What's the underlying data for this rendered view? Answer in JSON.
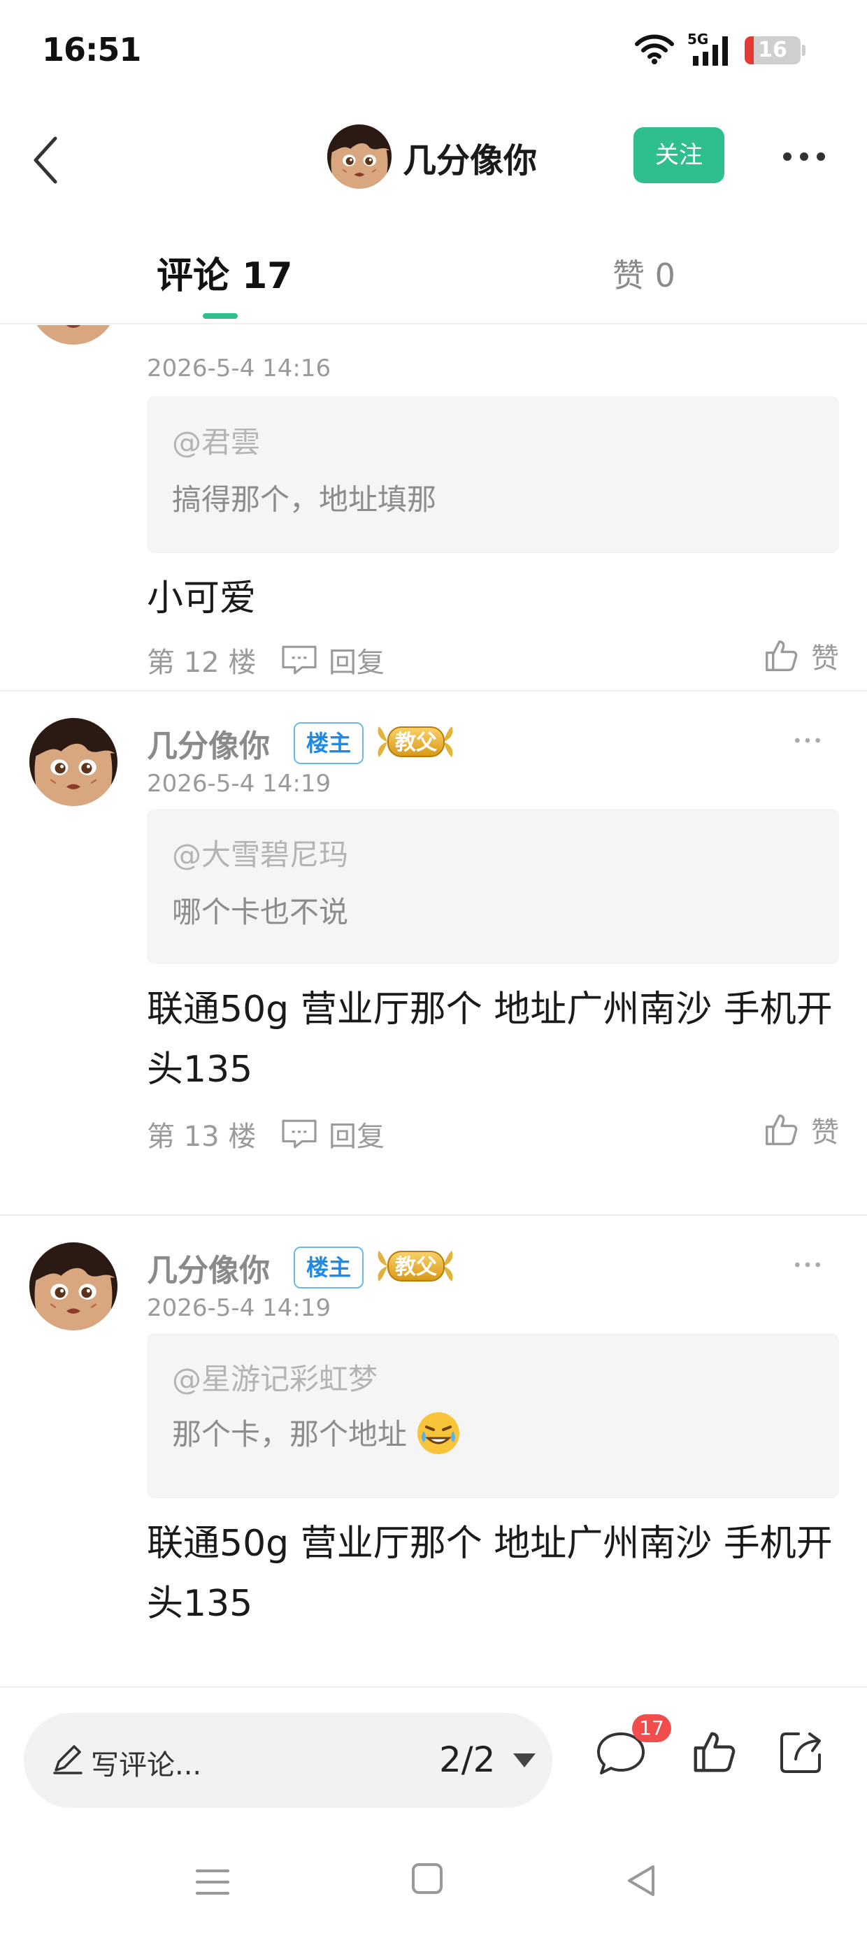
{
  "status_bar": {
    "time": "16:51",
    "network": "5G",
    "battery": "16",
    "battery_level": 0.16,
    "icons": [
      "wifi-icon",
      "signal-5g-icon",
      "battery-icon"
    ]
  },
  "header": {
    "author_name": "几分像你",
    "follow_label": "关注",
    "icons": [
      "back-arrow-icon",
      "more-dots-icon"
    ]
  },
  "tabs": {
    "comments_label": "评论 17",
    "likes_label": "赞 0"
  },
  "comments": [
    {
      "time": "2026-5-4 14:16",
      "quote_user": "@君雲",
      "quote_text": "搞得那个，地址填那",
      "text": "小可爱",
      "floor": "第 12 楼",
      "reply_label": "回复",
      "like_label": "赞"
    },
    {
      "author": "几分像你",
      "owner_badge": "楼主",
      "rank_badge": "教父",
      "time": "2026-5-4 14:19",
      "quote_user": "@大雪碧尼玛",
      "quote_text": "哪个卡也不说",
      "text": "联通50g 营业厅那个 地址广州南沙 手机开头135",
      "floor": "第 13 楼",
      "reply_label": "回复",
      "like_label": "赞"
    },
    {
      "author": "几分像你",
      "owner_badge": "楼主",
      "rank_badge": "教父",
      "time": "2026-5-4 14:19",
      "quote_user": "@星游记彩虹梦",
      "quote_text": "那个卡，那个地址",
      "quote_emoji": "tearful-grin-emoji",
      "text": "联通50g 营业厅那个 地址广州南沙 手机开头135"
    }
  ],
  "bottom_bar": {
    "input_placeholder": "写评论...",
    "page_indicator": "2/2",
    "comment_count_badge": "17",
    "icons": [
      "pencil-icon",
      "comment-icon",
      "thumbs-up-icon",
      "share-icon"
    ]
  },
  "colors": {
    "accent_green": "#2fbf8f",
    "owner_badge_blue": "#1f8ae6",
    "badge_red": "#f24d4d",
    "battery_red": "#e53935"
  }
}
